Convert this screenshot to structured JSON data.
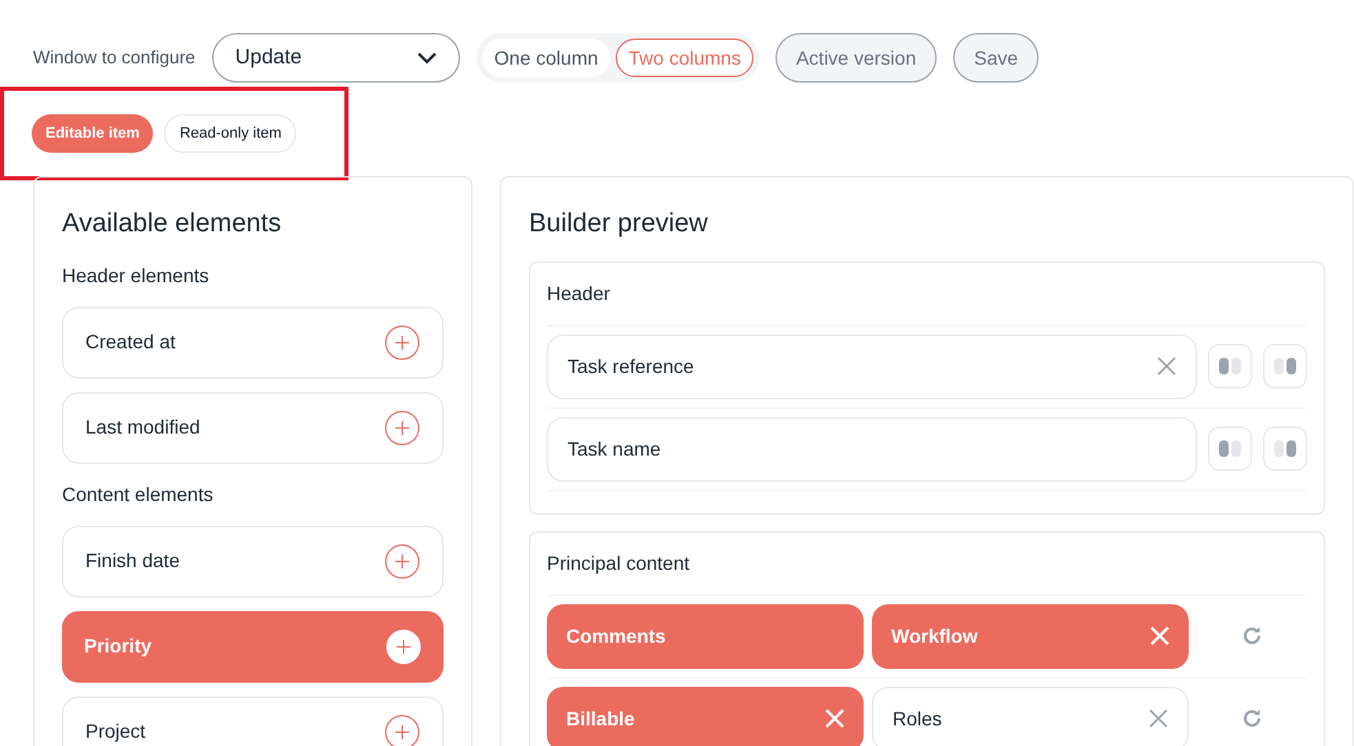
{
  "toolbar": {
    "label": "Window to configure",
    "select": {
      "value": "Update"
    },
    "layout_options": [
      {
        "label": "One column",
        "selected": false
      },
      {
        "label": "Two columns",
        "selected": true
      }
    ],
    "buttons": [
      "Active version",
      "Save"
    ]
  },
  "legend": [
    {
      "label": "Editable item",
      "editable": true
    },
    {
      "label": "Read-only item",
      "editable": false
    }
  ],
  "available": {
    "title": "Available elements",
    "groups": [
      {
        "title": "Header elements",
        "items": [
          {
            "label": "Created at",
            "editable": false
          },
          {
            "label": "Last modified",
            "editable": false
          }
        ]
      },
      {
        "title": "Content elements",
        "items": [
          {
            "label": "Finish date",
            "editable": false
          },
          {
            "label": "Priority",
            "editable": true
          },
          {
            "label": "Project",
            "editable": false
          }
        ]
      }
    ]
  },
  "preview": {
    "title": "Builder preview",
    "header": {
      "title": "Header",
      "rows": [
        {
          "label": "Task reference",
          "removable": true
        },
        {
          "label": "Task name",
          "removable": false
        }
      ]
    },
    "content": {
      "title": "Principal content",
      "rows": [
        {
          "cells": [
            {
              "label": "Comments",
              "editable": true,
              "removable": false
            },
            {
              "label": "Workflow",
              "editable": true,
              "removable": true
            }
          ]
        },
        {
          "cells": [
            {
              "label": "Billable",
              "editable": true,
              "removable": true
            },
            {
              "label": "Roles",
              "editable": false,
              "removable": true
            }
          ]
        }
      ]
    }
  }
}
